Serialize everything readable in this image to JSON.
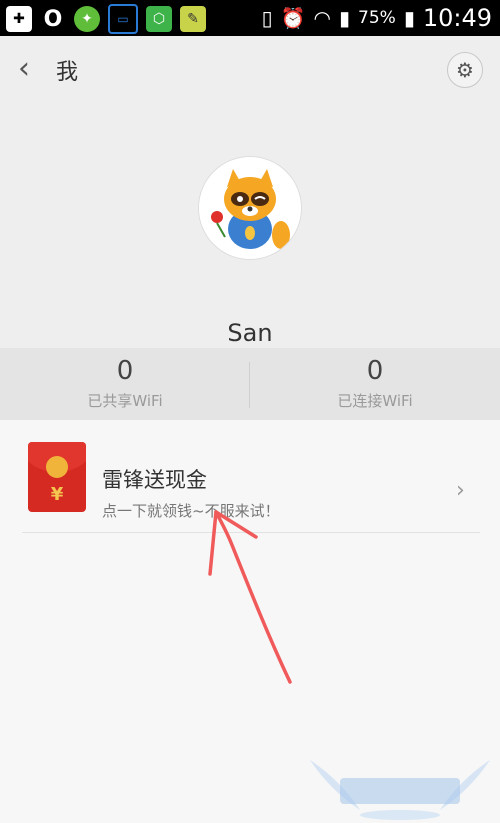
{
  "status_bar": {
    "icons": [
      "plus-box-icon",
      "zero-circle-icon",
      "game-icon",
      "drive-icon",
      "shield-app-icon",
      "note-icon"
    ],
    "battery": "75%",
    "time": "10:49"
  },
  "header": {
    "title": "我",
    "user_name": "San"
  },
  "stats": [
    {
      "value": "0",
      "label": "已共享WiFi"
    },
    {
      "value": "0",
      "label": "已连接WiFi"
    }
  ],
  "promo": {
    "title": "雷锋送现金",
    "subtitle": "点一下就领钱~不服来试！",
    "envelope_symbol": "¥"
  },
  "colors": {
    "envelope_red": "#d42a22",
    "arrow_red": "#f05a5a"
  }
}
